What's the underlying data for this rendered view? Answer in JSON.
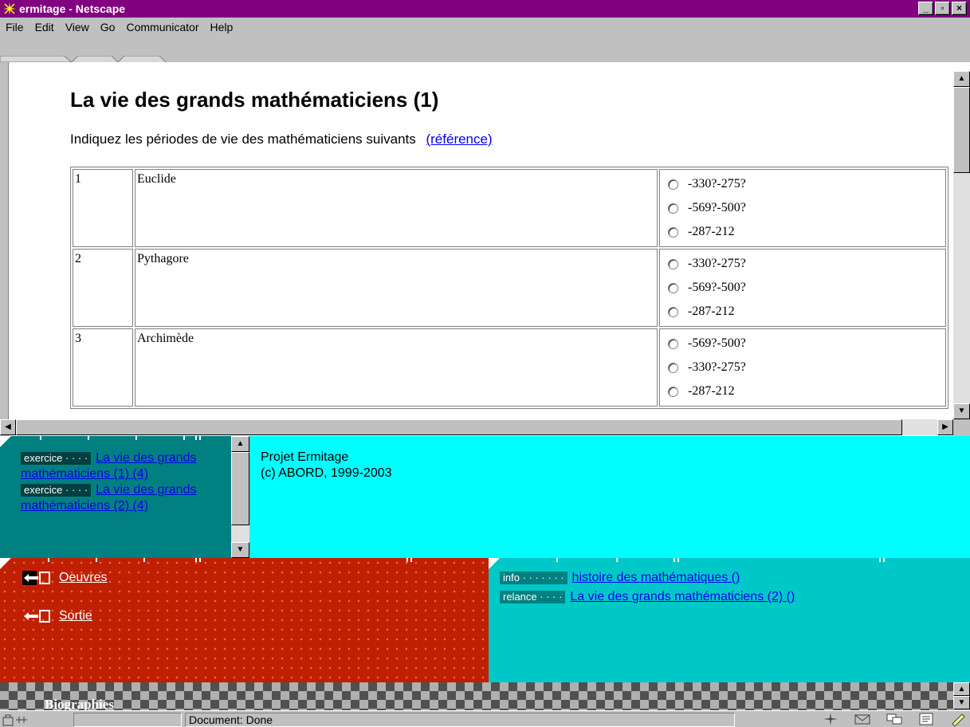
{
  "window": {
    "title": "ermitage - Netscape",
    "controls": [
      "_",
      "▫",
      "×"
    ]
  },
  "menu": {
    "items": [
      "File",
      "Edit",
      "View",
      "Go",
      "Communicator",
      "Help"
    ]
  },
  "page": {
    "title": "La vie des grands mathématiciens (1)",
    "instructions": "Indiquez les périodes de vie des mathématiciens suivants",
    "reference_link": "(référence)",
    "rows": [
      {
        "num": "1",
        "name": "Euclide",
        "options": [
          "-330?-275?",
          "-569?-500?",
          "-287-212"
        ]
      },
      {
        "num": "2",
        "name": "Pythagore",
        "options": [
          "-330?-275?",
          "-569?-500?",
          "-287-212"
        ]
      },
      {
        "num": "3",
        "name": "Archimède",
        "options": [
          "-569?-500?",
          "-330?-275?",
          "-287-212"
        ]
      }
    ]
  },
  "nav_frame": {
    "items": [
      {
        "tag": "exercice · · · ·",
        "link": "La vie des grands mathématiciens (1) (4)"
      },
      {
        "tag": "exercice · · · ·",
        "link": "La vie des grands mathématiciens (2) (4)"
      }
    ]
  },
  "info_frame": {
    "line1": "Projet Ermitage",
    "line2": "(c) ABORD, 1999-2003"
  },
  "red_frame": {
    "links": [
      "Oeuvres",
      "Sortie"
    ]
  },
  "teal_frame": {
    "rows": [
      {
        "tag": "info · · · · · · ·",
        "link": "histoire des mathématiques ()"
      },
      {
        "tag": "relance · · · ·",
        "link": "La vie des grands mathématiciens (2) ()"
      }
    ]
  },
  "bottom_strip": {
    "label": "Biographies"
  },
  "status": {
    "text": "Document: Done"
  },
  "colors": {
    "titlebar": "#800080",
    "nav_bg": "#008080",
    "info_bg": "#00ffff",
    "red_bg": "#c02000",
    "teal_bg": "#00c8c8",
    "link": "#0000ee"
  }
}
